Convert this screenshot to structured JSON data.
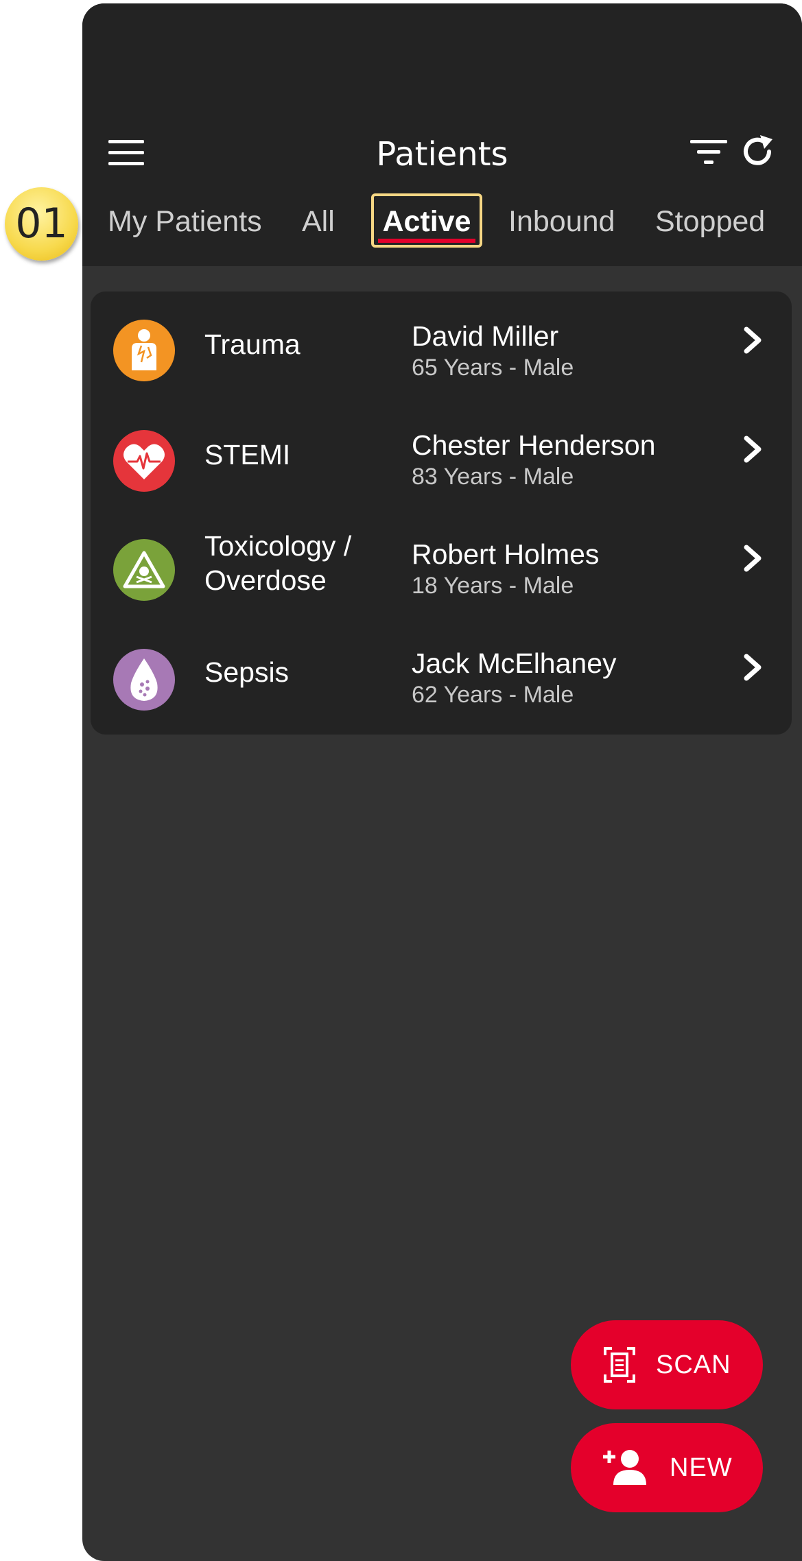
{
  "header": {
    "title": "Patients"
  },
  "tabs": [
    {
      "label": "My Patients"
    },
    {
      "label": "All"
    },
    {
      "label": "Active"
    },
    {
      "label": "Inbound"
    },
    {
      "label": "Stopped"
    }
  ],
  "active_tab": "Active",
  "callout": {
    "number": "01"
  },
  "patients": [
    {
      "category": "Trauma",
      "category_color": "#f39423",
      "icon": "trauma-icon",
      "name": "David Miller",
      "info": "65 Years - Male"
    },
    {
      "category": "STEMI",
      "category_color": "#e5353b",
      "icon": "heart-ecg-icon",
      "name": "Chester Henderson",
      "info": "83 Years - Male"
    },
    {
      "category": "Toxicology /\nOverdose",
      "category_color": "#7aa23a",
      "icon": "skull-warning-icon",
      "name": "Robert Holmes",
      "info": "18 Years - Male"
    },
    {
      "category": "Sepsis",
      "category_color": "#a779b5",
      "icon": "blood-drop-icon",
      "name": "Jack McElhaney",
      "info": "62 Years - Male"
    }
  ],
  "actions": {
    "scan_label": "SCAN",
    "new_label": "NEW"
  },
  "colors": {
    "accent": "#e4002b",
    "header_bg": "#232323",
    "body_bg": "#333333",
    "highlight": "#f6d784"
  }
}
